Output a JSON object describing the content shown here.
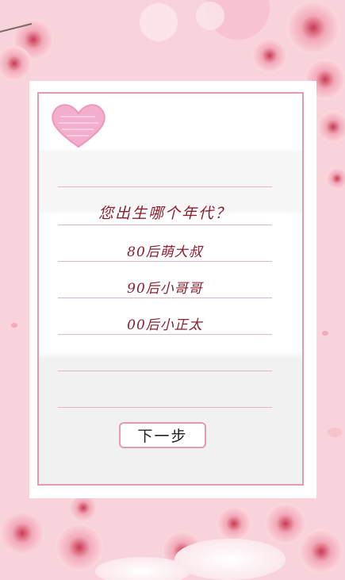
{
  "quiz": {
    "question": "您出生哪个年代？",
    "options": [
      "80后萌大叔",
      "90后小哥哥",
      "00后小正太"
    ],
    "next_label": "下一步"
  },
  "theme": {
    "background": "#f9d3dc",
    "accent": "#e39ab7",
    "text": "#8a1f2e"
  }
}
